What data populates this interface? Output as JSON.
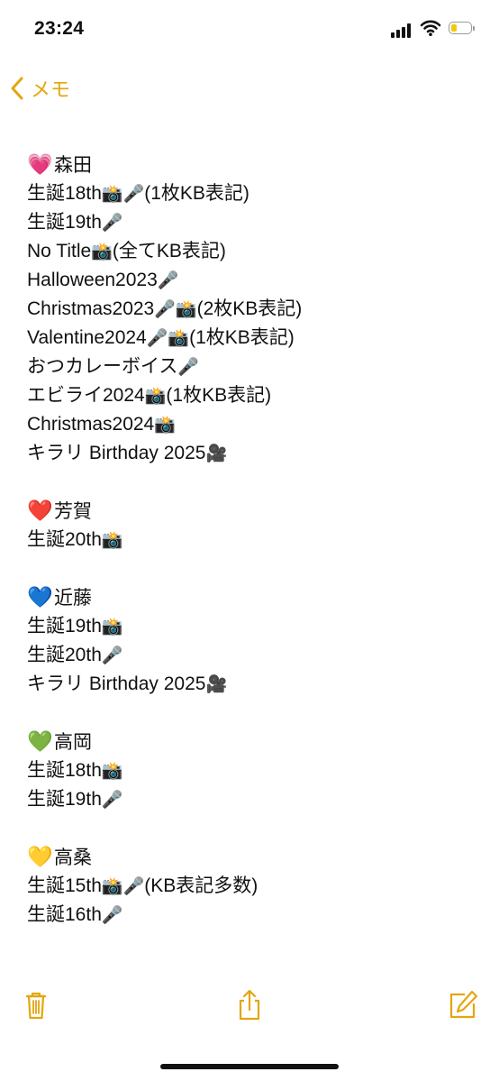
{
  "status": {
    "time": "23:24"
  },
  "nav": {
    "back_label": "メモ"
  },
  "groups": [
    {
      "heart": "💗",
      "heart_color": "#ff69b4",
      "name": "森田",
      "items": [
        {
          "base": "生誕18th",
          "icons": [
            "📸",
            "🎤"
          ],
          "suffix": "(1枚KB表記)"
        },
        {
          "base": "生誕19th",
          "icons": [
            "🎤"
          ],
          "suffix": ""
        },
        {
          "base": "No Title",
          "icons": [
            "📸"
          ],
          "suffix": "(全てKB表記)"
        },
        {
          "base": "Halloween2023",
          "icons": [
            "🎤"
          ],
          "suffix": ""
        },
        {
          "base": "Christmas2023",
          "icons": [
            "🎤",
            "📸"
          ],
          "suffix": "(2枚KB表記)"
        },
        {
          "base": "Valentine2024",
          "icons": [
            "🎤",
            "📸"
          ],
          "suffix": "(1枚KB表記)"
        },
        {
          "base": "おつカレーボイス",
          "icons": [
            "🎤"
          ],
          "suffix": ""
        },
        {
          "base": "エビライ2024",
          "icons": [
            "📸"
          ],
          "suffix": "(1枚KB表記)"
        },
        {
          "base": "Christmas2024",
          "icons": [
            "📸"
          ],
          "suffix": ""
        },
        {
          "base": "キラリ Birthday 2025",
          "icons": [
            "🎥"
          ],
          "suffix": ""
        }
      ]
    },
    {
      "heart": "❤️",
      "heart_color": "#e62222",
      "name": "芳賀",
      "items": [
        {
          "base": "生誕20th",
          "icons": [
            "📸"
          ],
          "suffix": ""
        }
      ]
    },
    {
      "heart": "💙",
      "heart_color": "#1f6fe0",
      "name": "近藤",
      "items": [
        {
          "base": "生誕19th",
          "icons": [
            "📸"
          ],
          "suffix": ""
        },
        {
          "base": "生誕20th",
          "icons": [
            "🎤"
          ],
          "suffix": ""
        },
        {
          "base": "キラリ Birthday 2025",
          "icons": [
            "🎥"
          ],
          "suffix": ""
        }
      ]
    },
    {
      "heart": "💚",
      "heart_color": "#2ebd3a",
      "name": "高岡",
      "items": [
        {
          "base": "生誕18th",
          "icons": [
            "📸"
          ],
          "suffix": ""
        },
        {
          "base": "生誕19th",
          "icons": [
            "🎤"
          ],
          "suffix": ""
        }
      ]
    },
    {
      "heart": "💛",
      "heart_color": "#f2c200",
      "name": "高桑",
      "items": [
        {
          "base": "生誕15th",
          "icons": [
            "📸",
            "🎤"
          ],
          "suffix": "(KB表記多数)"
        },
        {
          "base": "生誕16th",
          "icons": [
            "🎤"
          ],
          "suffix": ""
        }
      ]
    }
  ],
  "icons": {
    "📸": "camera-flash-icon",
    "🎤": "microphone-icon",
    "🎥": "movie-camera-icon"
  },
  "toolbar": {
    "icons": [
      "trash-icon",
      "share-icon",
      "compose-icon"
    ]
  },
  "colors": {
    "accent": "#e3a60e",
    "text": "#111111"
  }
}
